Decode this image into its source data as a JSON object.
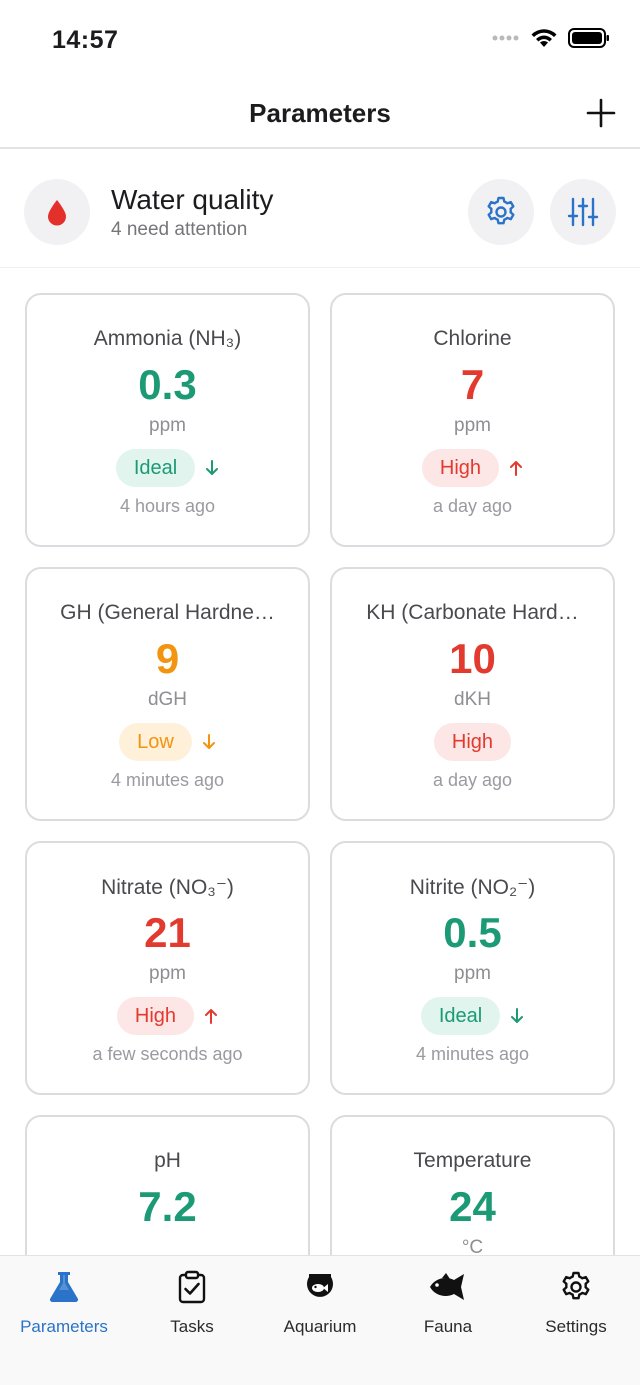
{
  "status_bar": {
    "time": "14:57"
  },
  "nav": {
    "title": "Parameters",
    "add_icon": "plus-icon"
  },
  "summary": {
    "title": "Water quality",
    "subtitle": "4 need attention",
    "icon": "water-drop-icon",
    "settings_icon": "gear-icon",
    "filter_icon": "sliders-icon"
  },
  "colors": {
    "green": "#1c9a75",
    "red": "#e23a2e",
    "orange": "#f2940f",
    "accent": "#2a73c9"
  },
  "cards": [
    {
      "name": "Ammonia (NH₃)",
      "value": "0.3",
      "unit": "ppm",
      "status": "Ideal",
      "trend": "down",
      "time": "4 hours ago"
    },
    {
      "name": "Chlorine",
      "value": "7",
      "unit": "ppm",
      "status": "High",
      "trend": "up",
      "time": "a day ago"
    },
    {
      "name": "GH (General Hardne…",
      "value": "9",
      "unit": "dGH",
      "status": "Low",
      "trend": "down",
      "time": "4 minutes ago"
    },
    {
      "name": "KH (Carbonate Hard…",
      "value": "10",
      "unit": "dKH",
      "status": "High",
      "trend": "",
      "time": "a day ago"
    },
    {
      "name": "Nitrate (NO₃⁻)",
      "value": "21",
      "unit": "ppm",
      "status": "High",
      "trend": "up",
      "time": "a few seconds ago"
    },
    {
      "name": "Nitrite (NO₂⁻)",
      "value": "0.5",
      "unit": "ppm",
      "status": "Ideal",
      "trend": "down",
      "time": "4 minutes ago"
    },
    {
      "name": "pH",
      "value": "7.2",
      "unit": "",
      "status": "",
      "trend": "",
      "time": ""
    },
    {
      "name": "Temperature",
      "value": "24",
      "unit": "°C",
      "status": "",
      "trend": "",
      "time": ""
    }
  ],
  "tabs": [
    {
      "label": "Parameters",
      "icon": "flask-icon",
      "active": true
    },
    {
      "label": "Tasks",
      "icon": "clipboard-check-icon",
      "active": false
    },
    {
      "label": "Aquarium",
      "icon": "fishbowl-icon",
      "active": false
    },
    {
      "label": "Fauna",
      "icon": "fish-icon",
      "active": false
    },
    {
      "label": "Settings",
      "icon": "gear-icon",
      "active": false
    }
  ]
}
